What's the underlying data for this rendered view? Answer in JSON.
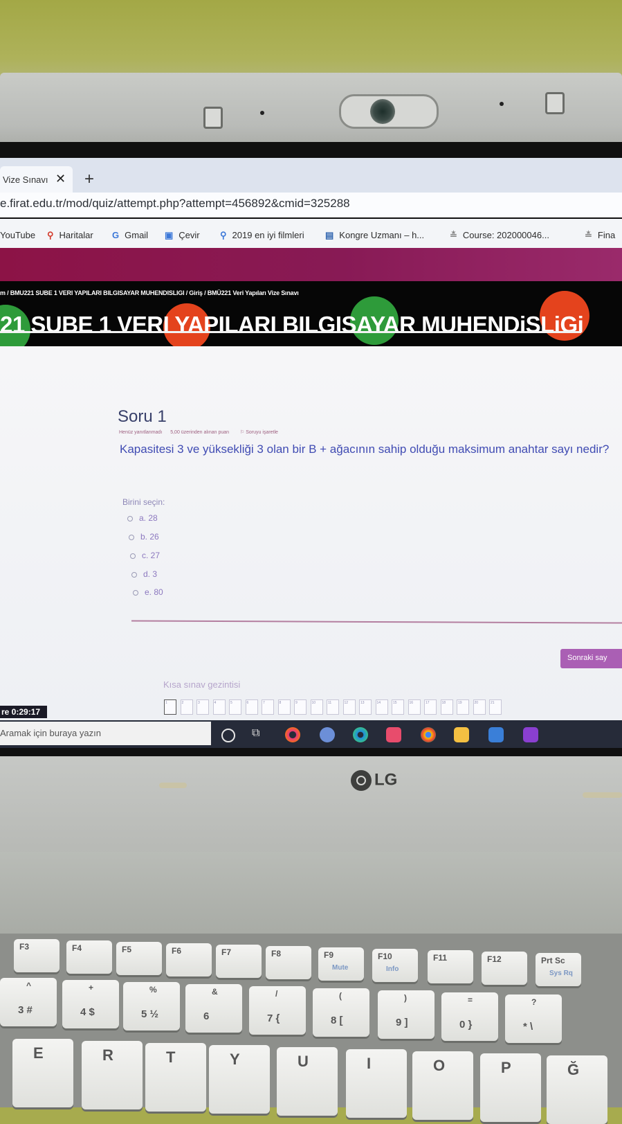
{
  "browser": {
    "tab_title": "Vize Sınavı",
    "tab_close": "✕",
    "new_tab": "+",
    "url": "e.firat.edu.tr/mod/quiz/attempt.php?attempt=456892&cmid=325288",
    "bookmarks": [
      {
        "label": "YouTube",
        "icon": ""
      },
      {
        "label": "Haritalar",
        "icon": "map-pin-icon"
      },
      {
        "label": "Gmail",
        "icon": "G"
      },
      {
        "label": "Çevir",
        "icon": "translate-icon"
      },
      {
        "label": "2019 en iyi filmleri",
        "icon": "search-icon"
      },
      {
        "label": "Kongre Uzmanı – h...",
        "icon": "window-icon"
      },
      {
        "label": "Course: 202000046...",
        "icon": "course-icon"
      },
      {
        "label": "Fina",
        "icon": "course-icon"
      }
    ]
  },
  "page": {
    "breadcrumb": "m / BMU221 SUBE 1 VERI YAPILARI BILGISAYAR MUHENDISLIGI / Giriş / BMÜ221 Veri Yapıları Vize Sınavı",
    "course_title": "21 SUBE 1 VERI YAPILARI BILGISAYAR MUHENDiSLiGi",
    "question": {
      "title": "Soru 1",
      "status": "Henüz yanıtlanmadı",
      "points": "5,00 üzerinden alınan puan",
      "flag": "Soruyu işaretle",
      "text": "Kapasitesi 3 ve yüksekliği 3 olan bir B + ağacının sahip olduğu maksimum anahtar sayı nedir?",
      "choose_label": "Birini seçin:",
      "options": [
        "a. 28",
        "b. 26",
        "c. 27",
        "d. 3",
        "e. 80"
      ]
    },
    "next_button": "Sonraki say",
    "nav_label": "Kısa sınav gezintisi",
    "nav_numbers": [
      "1",
      "2",
      "3",
      "4",
      "5",
      "6",
      "7",
      "8",
      "9",
      "10",
      "11",
      "12",
      "13",
      "14",
      "15",
      "16",
      "17",
      "18",
      "19",
      "20",
      "21"
    ],
    "timer": "re 0:29:17"
  },
  "taskbar": {
    "search_placeholder": "Aramak için buraya yazın"
  },
  "laptop": {
    "brand": "LG",
    "keys_fn": [
      {
        "top": "F3",
        "sub": ""
      },
      {
        "top": "F4",
        "sub": ""
      },
      {
        "top": "F5",
        "sub": ""
      },
      {
        "top": "F6",
        "sub": ""
      },
      {
        "top": "F7",
        "sub": ""
      },
      {
        "top": "F8",
        "sub": ""
      },
      {
        "top": "F9",
        "sub": "Mute"
      },
      {
        "top": "F10",
        "sub": "Info"
      },
      {
        "top": "F11",
        "sub": ""
      },
      {
        "top": "F12",
        "sub": ""
      },
      {
        "top": "Prt Sc",
        "sub": "Sys Rq"
      }
    ],
    "keys_num": [
      {
        "top": "^",
        "bottom": "3 #"
      },
      {
        "top": "+",
        "bottom": "4 $"
      },
      {
        "top": "%",
        "bottom": "5 ½"
      },
      {
        "top": "&",
        "bottom": "6"
      },
      {
        "top": "/",
        "bottom": "7 {"
      },
      {
        "top": "(",
        "bottom": "8 ["
      },
      {
        "top": ")",
        "bottom": "9 ]"
      },
      {
        "top": "=",
        "bottom": "0 }"
      },
      {
        "top": "?",
        "bottom": "* \\"
      }
    ],
    "keys_letters": [
      "E",
      "R",
      "T",
      "Y",
      "U",
      "I",
      "O",
      "P",
      "Ğ"
    ]
  },
  "colors": {
    "banner": "#8c1346",
    "question_text": "#404bb3",
    "option_text": "#8c78bf",
    "next_button": "#aa5fb4",
    "blob_green": "#2e9b3a",
    "blob_red": "#e4431d"
  }
}
